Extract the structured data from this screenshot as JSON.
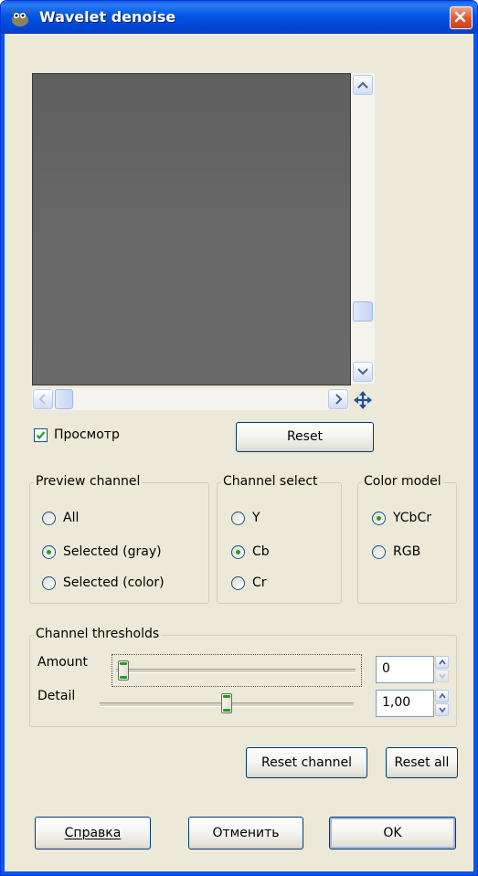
{
  "window": {
    "title": "Wavelet denoise"
  },
  "preview": {
    "checkbox_label": "Просмотр",
    "checkbox_checked": true,
    "reset_label": "Reset"
  },
  "preview_channel": {
    "title": "Preview channel",
    "options": [
      "All",
      "Selected (gray)",
      "Selected (color)"
    ],
    "selected": "Selected (gray)"
  },
  "channel_select": {
    "title": "Channel select",
    "options": [
      "Y",
      "Cb",
      "Cr"
    ],
    "selected": "Cb"
  },
  "color_model": {
    "title": "Color model",
    "options": [
      "YCbCr",
      "RGB"
    ],
    "selected": "YCbCr"
  },
  "thresholds": {
    "title": "Channel thresholds",
    "amount_label": "Amount",
    "amount_value": "0",
    "detail_label": "Detail",
    "detail_value": "1,00"
  },
  "actions": {
    "reset_channel": "Reset channel",
    "reset_all": "Reset all"
  },
  "footer": {
    "help": "Справка",
    "cancel": "Отменить",
    "ok": "OK"
  },
  "colors": {
    "titlebar": "#0055e5",
    "dialog_bg": "#ece9d8",
    "radio_dot": "#21a121"
  }
}
